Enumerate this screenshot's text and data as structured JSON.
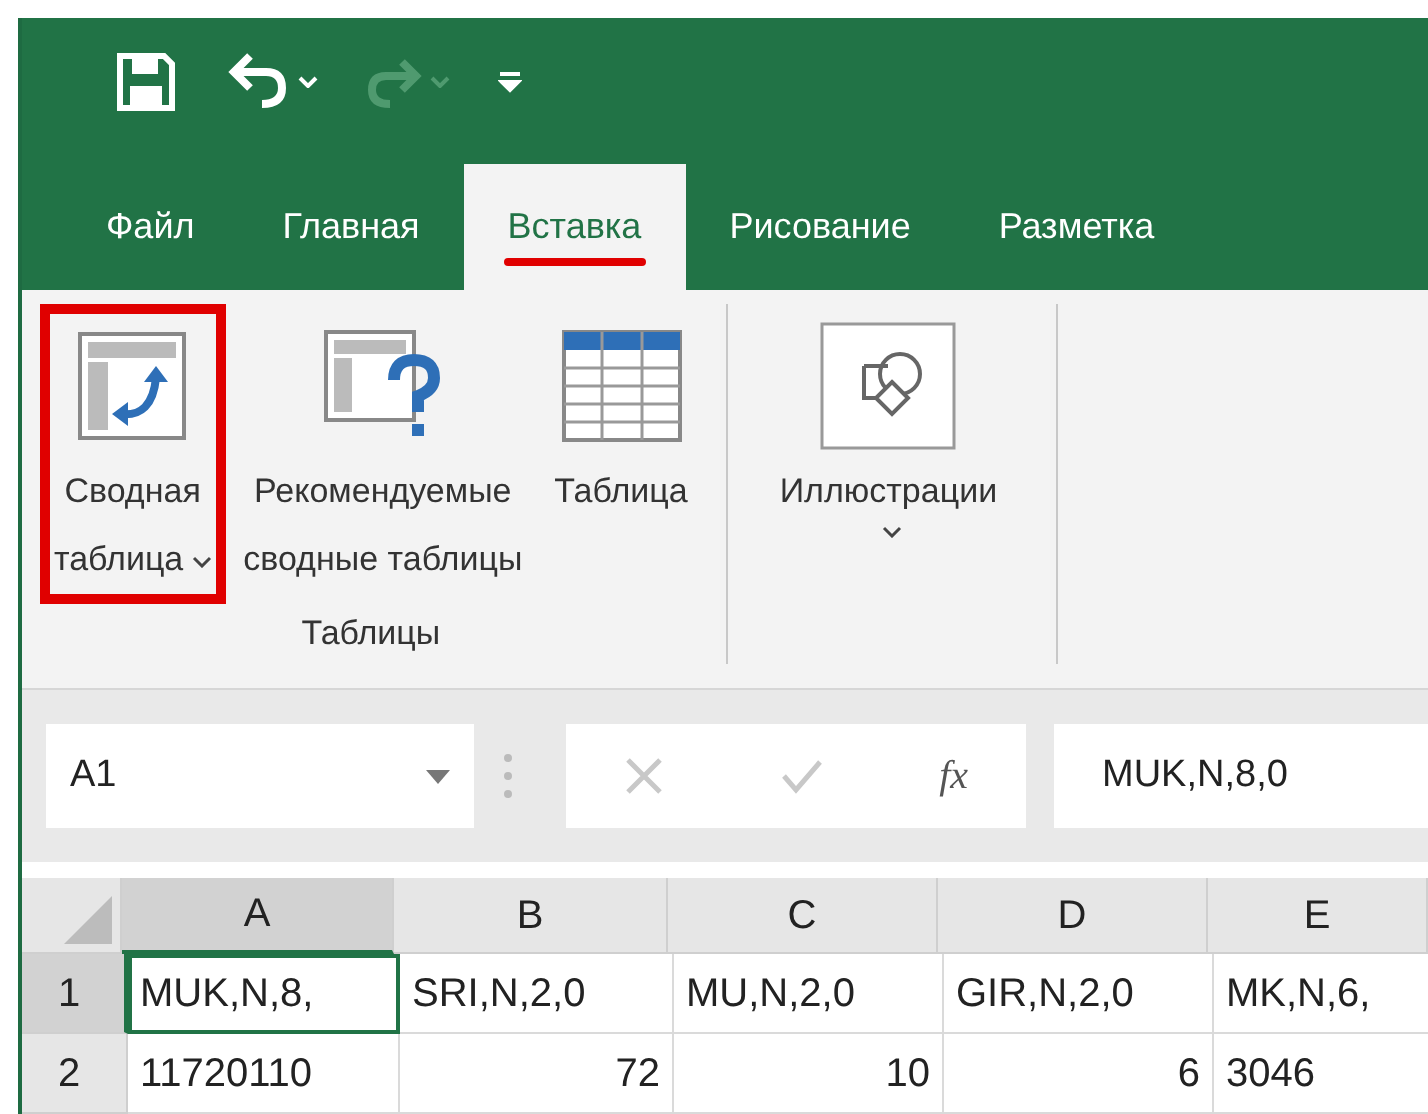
{
  "quick_access": {
    "redo_enabled": false
  },
  "tabs": [
    {
      "label": "Файл",
      "selected": false,
      "underlined": false
    },
    {
      "label": "Главная",
      "selected": false,
      "underlined": false
    },
    {
      "label": "Вставка",
      "selected": true,
      "underlined": true
    },
    {
      "label": "Рисование",
      "selected": false,
      "underlined": false
    },
    {
      "label": "Разметка",
      "selected": false,
      "underlined": false
    }
  ],
  "ribbon_groups": [
    {
      "label": "Таблицы",
      "commands": [
        {
          "kind": "pivot",
          "lines": [
            "Сводная",
            "таблица"
          ],
          "dropdown": true,
          "highlighted": true
        },
        {
          "kind": "recommended",
          "lines": [
            "Рекомендуемые",
            "сводные таблицы"
          ],
          "dropdown": false,
          "highlighted": false
        },
        {
          "kind": "table",
          "lines": [
            "Таблица"
          ],
          "dropdown": false,
          "highlighted": false
        }
      ]
    },
    {
      "commands": [
        {
          "kind": "illustrations",
          "lines": [
            "Иллюстрации"
          ],
          "dropdown": true,
          "highlighted": false
        }
      ]
    }
  ],
  "name_box": "A1",
  "function_label": "fx",
  "formula": "MUK,N,8,0",
  "columns": [
    {
      "label": "A",
      "selected": true
    },
    {
      "label": "B",
      "selected": false
    },
    {
      "label": "C",
      "selected": false
    },
    {
      "label": "D",
      "selected": false
    },
    {
      "label": "E",
      "selected": false
    }
  ],
  "rows": [
    {
      "number": "1",
      "selected": true,
      "cells": [
        {
          "value": "MUK,N,8,",
          "numeric": false,
          "active": true
        },
        {
          "value": "SRI,N,2,0",
          "numeric": false,
          "active": false
        },
        {
          "value": "MU,N,2,0",
          "numeric": false,
          "active": false
        },
        {
          "value": "GIR,N,2,0",
          "numeric": false,
          "active": false
        },
        {
          "value": "MK,N,6,",
          "numeric": false,
          "active": false
        }
      ]
    },
    {
      "number": "2",
      "selected": false,
      "cells": [
        {
          "value": "11720110",
          "numeric": false,
          "active": false
        },
        {
          "value": "72",
          "numeric": true,
          "active": false
        },
        {
          "value": "10",
          "numeric": true,
          "active": false
        },
        {
          "value": "6",
          "numeric": true,
          "active": false
        },
        {
          "value": "3046",
          "numeric": false,
          "active": false
        }
      ]
    }
  ]
}
